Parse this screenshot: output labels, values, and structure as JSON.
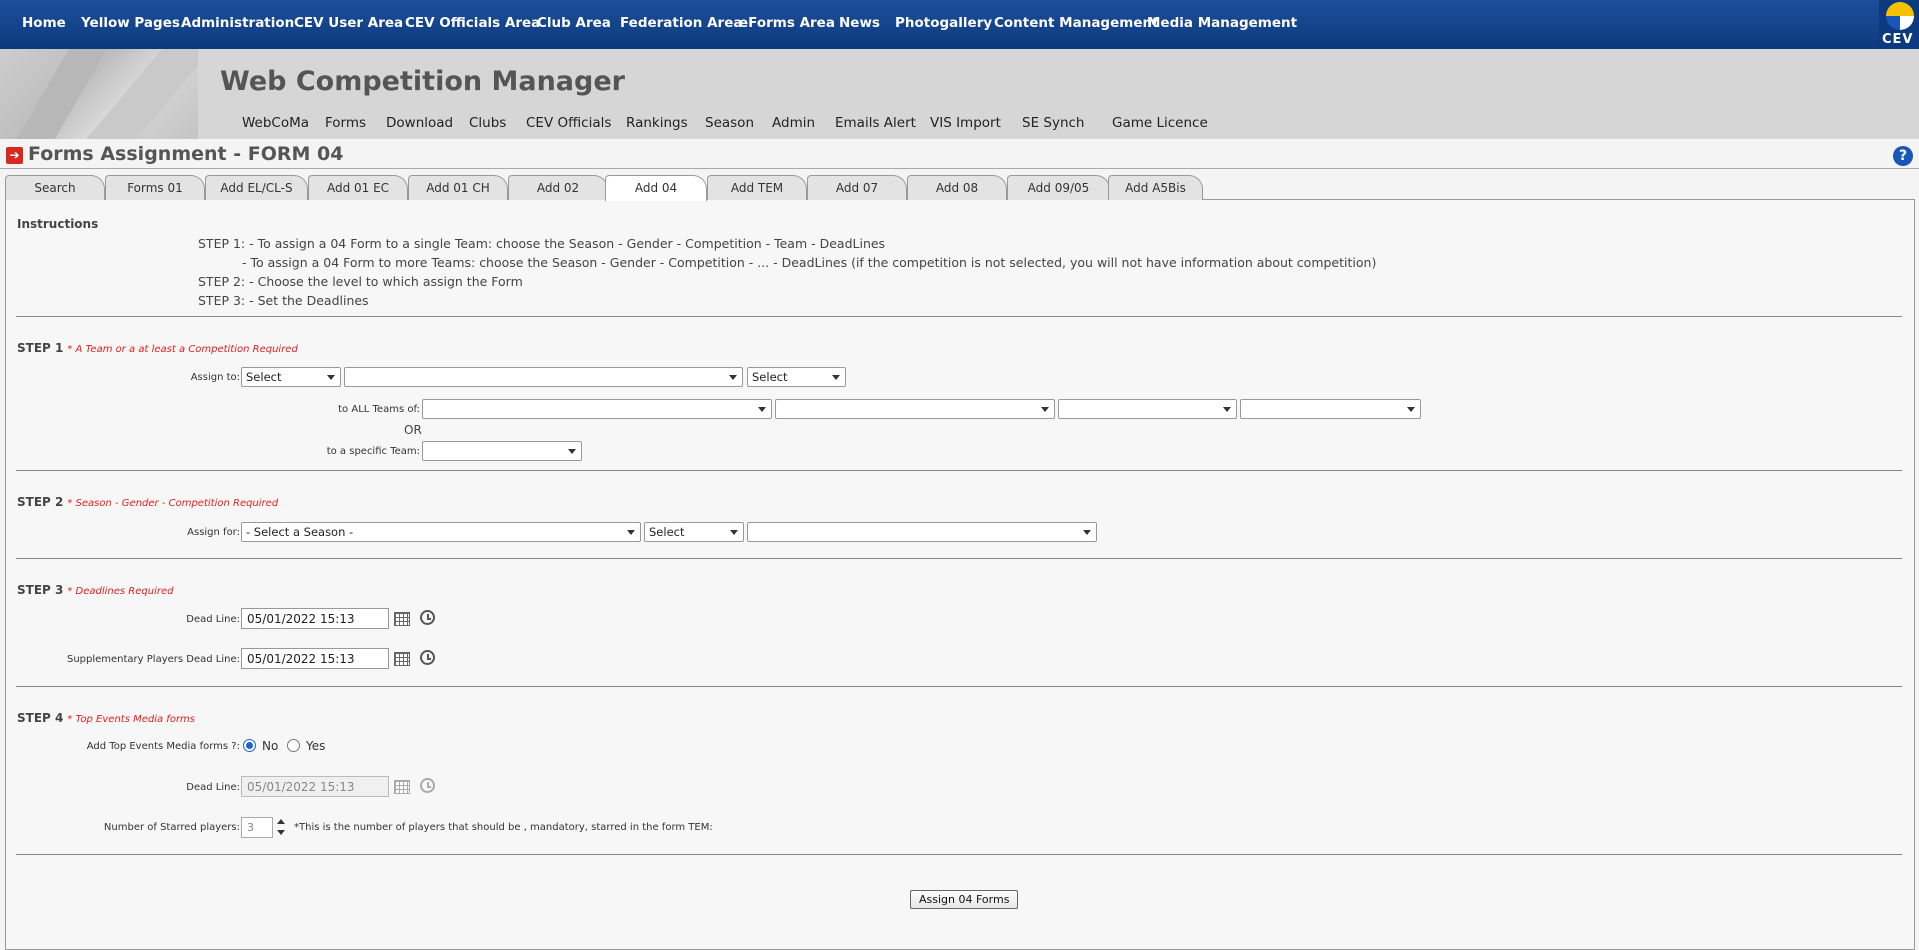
{
  "topnav": {
    "items": [
      "Home",
      "Yellow Pages",
      "Administration",
      "CEV User Area",
      "CEV Officials Area",
      "Club Area",
      "Federation Area",
      "eForms Area",
      "News",
      "Photogallery",
      "Content Management",
      "Media Management"
    ],
    "logo_text": "CEV"
  },
  "header": {
    "title": "Web Competition Manager",
    "subnav": [
      "WebCoMa",
      "Forms",
      "Download",
      "Clubs",
      "CEV Officials",
      "Rankings",
      "Season",
      "Admin",
      "Emails Alert",
      "VIS Import",
      "SE Synch",
      "Game Licence"
    ]
  },
  "page": {
    "title": "Forms Assignment - FORM 04",
    "help_glyph": "?"
  },
  "tabs": [
    "Search",
    "Forms 01",
    "Add EL/CL-S",
    "Add 01 EC",
    "Add 01 CH",
    "Add 02",
    "Add 04",
    "Add TEM",
    "Add 07",
    "Add 08",
    "Add 09/05",
    "Add A5Bis"
  ],
  "instructions": {
    "heading": "Instructions",
    "lines": [
      "STEP 1: - To assign a 04 Form to a single Team: choose the Season - Gender - Competition - Team - DeadLines",
      "- To assign a 04 Form to more Teams: choose the Season - Gender - Competition - ... - DeadLines (if the competition is not selected, you will not have information about competition)",
      "STEP 2: - Choose the level to which assign the Form",
      "STEP 3: - Set the Deadlines"
    ]
  },
  "step1": {
    "heading": "STEP 1",
    "required": "* A Team or a at least a Competition Required",
    "assign_to_label": "Assign to:",
    "assign_to_select1": "Select",
    "assign_to_select2": "",
    "assign_to_select3": "Select",
    "all_teams_label": "to ALL Teams of:",
    "or_label": "OR",
    "specific_team_label": "to a specific Team:"
  },
  "step2": {
    "heading": "STEP 2",
    "required": "* Season - Gender - Competition Required",
    "assign_for_label": "Assign for:",
    "season_select": "- Select a Season -",
    "gender_select": "Select",
    "competition_select": ""
  },
  "step3": {
    "heading": "STEP 3",
    "required": "* Deadlines Required",
    "deadline_label": "Dead Line:",
    "deadline_value": "05/01/2022 15:13",
    "supp_label": "Supplementary Players Dead Line:",
    "supp_value": "05/01/2022 15:13"
  },
  "step4": {
    "heading": "STEP 4",
    "required": "* Top Events Media forms",
    "add_label": "Add Top Events Media forms ?:",
    "radio_no": "No",
    "radio_yes": "Yes",
    "radio_selected": "No",
    "deadline_label": "Dead Line:",
    "deadline_value": "05/01/2022 15:13",
    "starred_label": "Number of Starred players:",
    "starred_value": "3",
    "starred_note": "*This is the number of players that should be , mandatory, starred in the form TEM:"
  },
  "submit_label": "Assign 04 Forms"
}
